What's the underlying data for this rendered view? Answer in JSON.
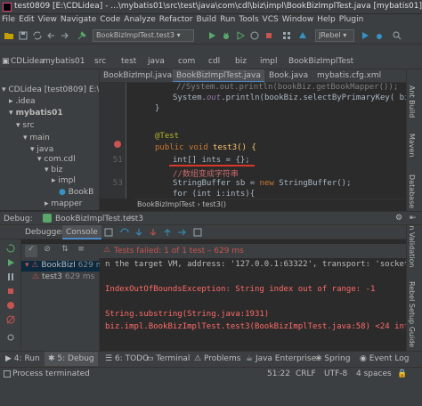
{
  "window": {
    "title": "test0809 [E:\\CDLidea] - ...\\mybatis01\\src\\test\\java\\com\\cdl\\biz\\impl\\BookBizImplTest.java [mybatis01] - Intelli"
  },
  "menu": [
    "File",
    "Edit",
    "View",
    "Navigate",
    "Code",
    "Analyze",
    "Refactor",
    "Build",
    "Run",
    "Tools",
    "VCS",
    "Window",
    "Help",
    "Plugin"
  ],
  "toolbar": {
    "run_config": "BookBizImplTest.test3",
    "jrebel": "JRebel"
  },
  "navbar": {
    "crumbs": [
      "CDLidea",
      "mybatis01",
      "src",
      "test",
      "java",
      "com",
      "cdl",
      "biz",
      "impl",
      "BookBizImplTest"
    ]
  },
  "project_tree": [
    {
      "label": "CDLidea [test0809] E:\\CDLid"
    },
    {
      "label": ".idea"
    },
    {
      "label": "mybatis01"
    },
    {
      "label": "src"
    },
    {
      "label": "main"
    },
    {
      "label": "java"
    },
    {
      "label": "com.cdl"
    },
    {
      "label": "biz"
    },
    {
      "label": "impl"
    },
    {
      "label": "BookB"
    },
    {
      "label": "mapper"
    }
  ],
  "editor_tabs": [
    {
      "label": "BookBizImpl.java"
    },
    {
      "label": "BookBizImplTest.java"
    },
    {
      "label": "Book.java"
    },
    {
      "label": "mybatis.cfg.xml"
    }
  ],
  "code": {
    "line_top": "//System.out.println(bookBiz.getBookMapper());",
    "line_print": "System.",
    "line_print_field": "out",
    "line_print_rest": ".println(bookBiz.selectByPrimaryKey( bid: 44",
    "line_brace": "}",
    "annotation": "@Test",
    "method_kw1": "public",
    "method_kw2": "void",
    "method_name": "test3() {",
    "line51_num": "51",
    "line51": "int[] ints = {};",
    "comment": "//数组变成字符串",
    "sb_line_a": "StringBuffer sb = ",
    "sb_line_kw": "new",
    "sb_line_b": " StringBuffer();",
    "for_line": "for (int i:ints){",
    "line53_num": "53"
  },
  "editor_breadcrumb": {
    "class": "BookBizImplTest",
    "method": "test3()"
  },
  "right_strip": [
    "Ant Build",
    "Maven",
    "Database",
    "Bean Validation",
    "Rebel Setup Guide"
  ],
  "debug": {
    "label": "Debug:",
    "session": "BookBizImplTest.test3",
    "tabs": [
      "Debugger",
      "Console"
    ],
    "tests_failed": "Tests failed: 1 of 1 test – 629 ms",
    "tree": [
      {
        "label": "BookBizI",
        "time": "629 ms"
      },
      {
        "label": "test3",
        "time": "629 ms"
      }
    ],
    "console": [
      "n the target VM, address: '127.0.0.1:63322', transport: 'socket'",
      "IndexOutOfBoundsException: String index out of range: -1",
      "String.substring(String.java:1931)",
      "biz.impl.BookBizImplTest.test3(BookBizImplTest.java:58) <24 inte"
    ],
    "console_link1": "String.java:1931",
    "console_link2": "BookBizImplTest.java:58"
  },
  "bottom_tools": [
    {
      "num": "4",
      "label": "Run"
    },
    {
      "num": "5",
      "label": "Debug"
    },
    {
      "num": "6",
      "label": "TODO"
    },
    {
      "num": "",
      "label": "Terminal"
    },
    {
      "num": "",
      "label": "Problems"
    },
    {
      "num": "",
      "label": "Java Enterprise"
    },
    {
      "num": "",
      "label": "Spring"
    },
    {
      "num": "",
      "label": "Event Log"
    }
  ],
  "status": {
    "left": "Process terminated",
    "position": "51:22",
    "crlf": "CRLF",
    "encoding": "UTF-8",
    "indent": "4 spaces"
  }
}
